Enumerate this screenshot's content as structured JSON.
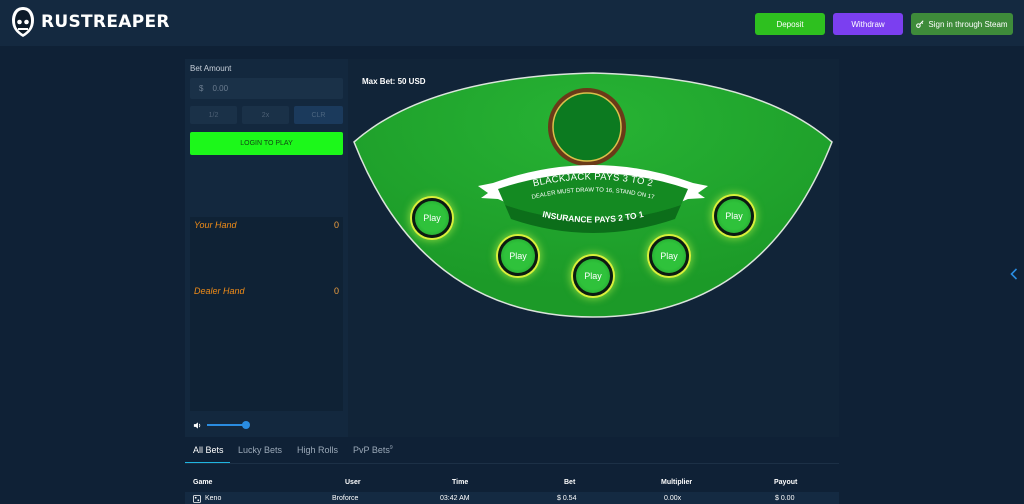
{
  "header": {
    "brand": "RUSTREAPER",
    "deposit_label": "Deposit",
    "withdraw_label": "Withdraw",
    "steam_label": "Sign in through Steam"
  },
  "sidebar": {
    "bet_amount_label": "Bet Amount",
    "amount_currency": "$",
    "amount_value": "0.00",
    "half_label": "1/2",
    "double_label": "2x",
    "clear_label": "CLR",
    "login_label": "LOGIN TO PLAY",
    "your_hand_label": "Your Hand",
    "your_hand_value": "0",
    "dealer_hand_label": "Dealer Hand",
    "dealer_hand_value": "0"
  },
  "table": {
    "max_bet": "Max Bet: 50 USD",
    "pays_line": "BLACKJACK PAYS 3 TO 2",
    "rule_line": "DEALER MUST DRAW TO 16, STAND ON 17",
    "insurance_line": "INSURANCE PAYS 2 TO 1",
    "seats": [
      "Play",
      "Play",
      "Play",
      "Play",
      "Play"
    ]
  },
  "tabs": [
    {
      "label": "All Bets",
      "active": true
    },
    {
      "label": "Lucky Bets",
      "active": false
    },
    {
      "label": "High Rolls",
      "active": false
    },
    {
      "label": "PvP Bets",
      "badge": "9",
      "active": false
    }
  ],
  "bets": {
    "columns": [
      "Game",
      "User",
      "Time",
      "Bet",
      "Multiplier",
      "Payout"
    ],
    "rows": [
      {
        "game": "Keno",
        "user": "Broforce",
        "time": "03:42 AM",
        "bet": "$ 0.54",
        "multiplier": "0.00x",
        "payout": "$ 0.00"
      }
    ]
  },
  "colors": {
    "felt": "#22a82e",
    "felt_dark": "#0f7a22",
    "login_button": "#1cf81a",
    "deposit_button": "#2ec01f",
    "withdraw_button": "#7b3ff0",
    "hand_label": "#f08c18",
    "tab_active": "#1fb5e0"
  }
}
